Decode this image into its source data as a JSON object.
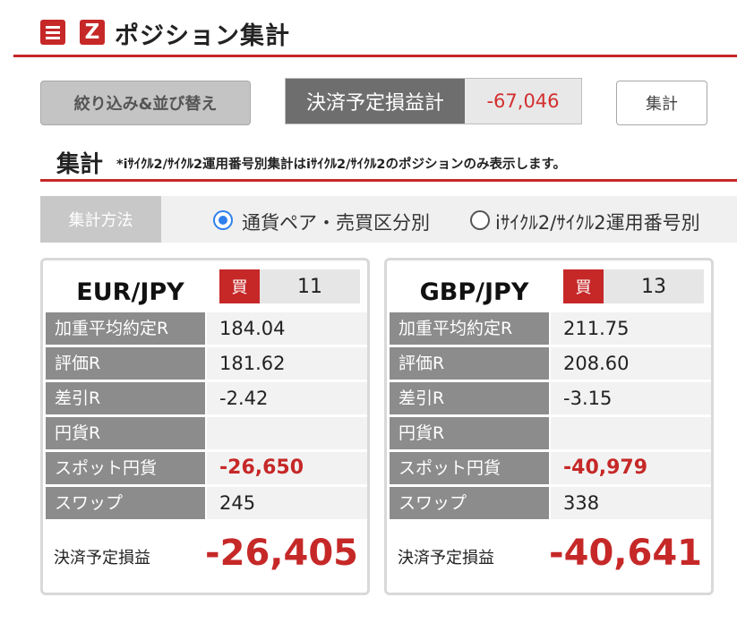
{
  "header": {
    "title": "ポジション集計",
    "menu_icon": "hamburger-menu-icon",
    "z_icon": "z-logo-icon",
    "accent_color": "#c62828"
  },
  "controls": {
    "filter_button": "絞り込み&並び替え",
    "pl_label": "決済予定損益計",
    "pl_value": "-67,046",
    "sum_button": "集計"
  },
  "section": {
    "title": "集計",
    "note": "*iｻｲｸﾙ2/ｻｲｸﾙ2運用番号別集計はiｻｲｸﾙ2/ｻｲｸﾙ2のポジションのみ表示します。"
  },
  "method": {
    "label": "集計方法",
    "options": [
      {
        "label": "通貨ペア・売買区分別",
        "selected": true
      },
      {
        "label": "iｻｲｸﾙ2/ｻｲｸﾙ2運用番号別",
        "selected": false
      }
    ]
  },
  "cards": [
    {
      "pair": "EUR/JPY",
      "side": "買",
      "qty": "11",
      "rows": [
        {
          "label": "加重平均約定R",
          "value": "184.04"
        },
        {
          "label": "評価R",
          "value": "181.62"
        },
        {
          "label": "差引R",
          "value": "-2.42"
        },
        {
          "label": "円貨R",
          "value": ""
        },
        {
          "label": "スポット円貨",
          "value": "-26,650"
        },
        {
          "label": "スワップ",
          "value": "245"
        }
      ],
      "footer_label": "決済予定損益",
      "footer_value": "-26,405"
    },
    {
      "pair": "GBP/JPY",
      "side": "買",
      "qty": "13",
      "rows": [
        {
          "label": "加重平均約定R",
          "value": "211.75"
        },
        {
          "label": "評価R",
          "value": "208.60"
        },
        {
          "label": "差引R",
          "value": "-3.15"
        },
        {
          "label": "円貨R",
          "value": ""
        },
        {
          "label": "スポット円貨",
          "value": "-40,979"
        },
        {
          "label": "スワップ",
          "value": "338"
        }
      ],
      "footer_label": "決済予定損益",
      "footer_value": "-40,641"
    }
  ]
}
